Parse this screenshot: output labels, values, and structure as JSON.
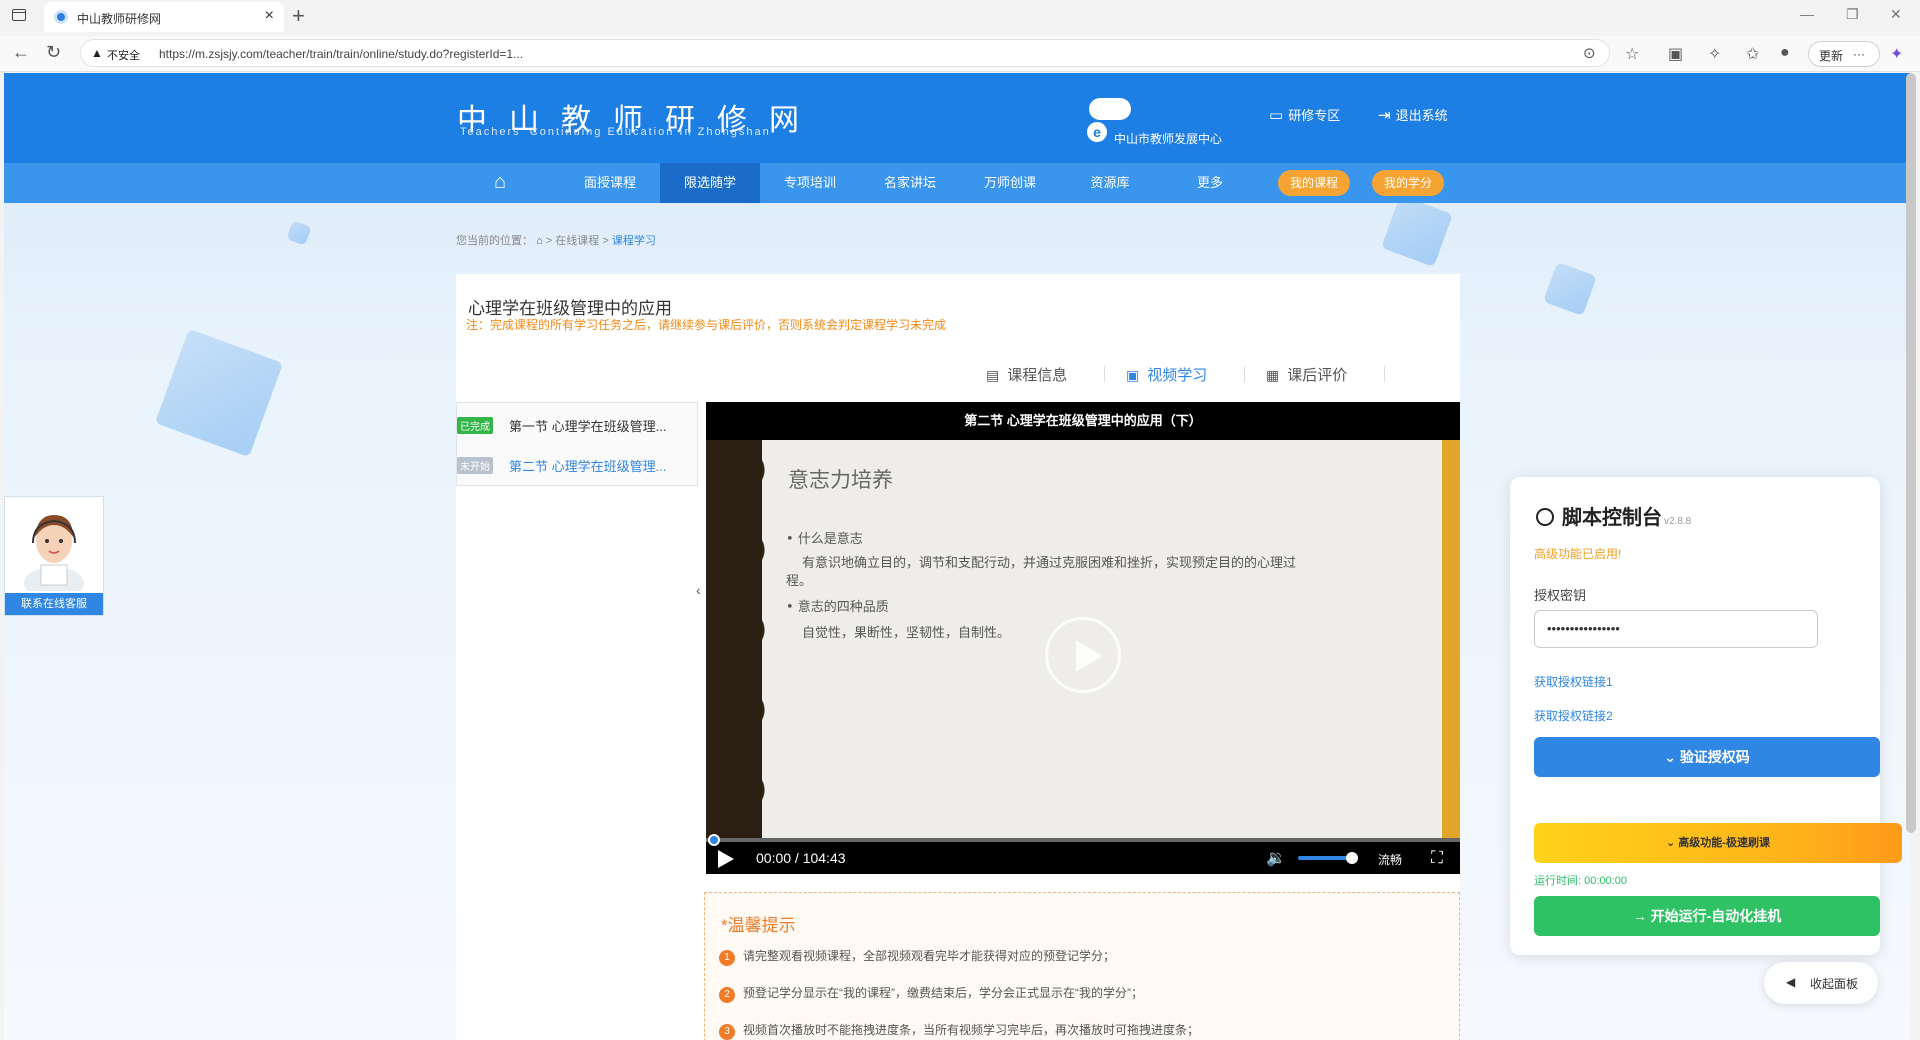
{
  "browser": {
    "tab_title": "中山教师研修网",
    "close_tab": "×",
    "new_tab": "+",
    "insecure_label": "不安全",
    "url": "https://m.zsjsjy.com/teacher/train/train/online/study.do?registerId=1...",
    "update_label": "更新",
    "more_label": "···"
  },
  "header": {
    "logo_cn": "中山教师研修网",
    "logo_en": "Teachers' Continuing Education In Zhongshan",
    "center_name": "中山市教师发展中心",
    "links": [
      "研修专区",
      "退出系统"
    ]
  },
  "menu": {
    "items": [
      "面授课程",
      "限选随学",
      "专项培训",
      "名家讲坛",
      "万师创课",
      "资源库",
      "更多"
    ],
    "active_index": 1,
    "pills": [
      "我的课程",
      "我的学分"
    ]
  },
  "breadcrumb": {
    "prefix": "您当前的位置：",
    "items": [
      "在线课程",
      "课程学习"
    ],
    "sep": ">"
  },
  "course": {
    "title": "心理学在班级管理中的应用",
    "note": "注：完成课程的所有学习任务之后，请继续参与课后评价，否则系统会判定课程学习未完成",
    "tabs": [
      "课程信息",
      "视频学习",
      "课后评价"
    ],
    "active_tab": 1,
    "chapters": [
      {
        "tag": "已完成",
        "tag_color": "#32b64a",
        "name": "第一节 心理学在班级管理..."
      },
      {
        "tag": "未开始",
        "tag_color": "#b8c2cf",
        "name": "第二节 心理学在班级管理..."
      }
    ]
  },
  "player": {
    "title": "第二节 心理学在班级管理中的应用（下）",
    "slide_heading": "意志力培养",
    "slide_lines": [
      "• 什么是意志",
      "有意识地确立目的，调节和支配行动，并通过克服困难和挫折，实现预定目的的心理过",
      "程。",
      "• 意志的四种品质",
      "自觉性，果断性，坚韧性，自制性。"
    ],
    "time": "00:00 / 104:43",
    "progress": 0,
    "volume": 0.85,
    "quality": "流畅"
  },
  "tips": {
    "title": "*温馨提示",
    "items": [
      "请完整观看视频课程，全部视频观看完毕才能获得对应的预登记学分；",
      "预登记学分显示在“我的课程”，缴费结束后，学分会正式显示在“我的学分”；",
      "视频首次播放时不能拖拽进度条，当所有视频学习完毕后，再次播放时可拖拽进度条；"
    ]
  },
  "service": {
    "label": "联系在线客服"
  },
  "script_panel": {
    "title": "脚本控制台",
    "version": "v2.8.8",
    "enabled_text": "高级功能已启用!",
    "key_label": "授权密钥",
    "key_value": "••••••••••••••••",
    "links": [
      "获取授权链接1",
      "获取授权链接2"
    ],
    "verify_button": "验证授权码",
    "advanced_button": "高级功能-极速刷课",
    "runtime": "运行时间: 00:00:00",
    "run_button": "开始运行-自动化挂机",
    "collapse_button": "收起面板"
  }
}
